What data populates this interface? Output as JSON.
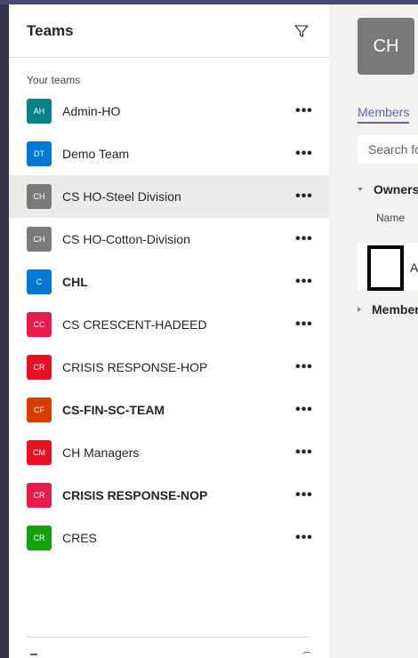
{
  "teams_pane": {
    "title": "Teams",
    "filter_icon": "filter-icon",
    "section_label": "Your teams",
    "more_icon": "more-options-icon",
    "more_glyph": "•••",
    "teams": [
      {
        "initials": "AH",
        "name": "Admin-HO",
        "color": "#038387",
        "bold": false,
        "selected": false
      },
      {
        "initials": "DT",
        "name": "Demo Team",
        "color": "#0078d4",
        "bold": false,
        "selected": false
      },
      {
        "initials": "CH",
        "name": "CS HO-Steel Division",
        "color": "#7a7a7a",
        "bold": false,
        "selected": true
      },
      {
        "initials": "CH",
        "name": "CS HO-Cotton-Division",
        "color": "#7a7a7a",
        "bold": false,
        "selected": false
      },
      {
        "initials": "C",
        "name": "CHL",
        "color": "#0078d4",
        "bold": true,
        "selected": false
      },
      {
        "initials": "CC",
        "name": "CS CRESCENT-HADEED",
        "color": "#e81b4c",
        "bold": false,
        "selected": false
      },
      {
        "initials": "CR",
        "name": "CRISIS RESPONSE-HOP",
        "color": "#e81123",
        "bold": false,
        "selected": false
      },
      {
        "initials": "CF",
        "name": "CS-FIN-SC-TEAM",
        "color": "#da3b01",
        "bold": true,
        "selected": false
      },
      {
        "initials": "CM",
        "name": "CH Managers",
        "color": "#e81123",
        "bold": false,
        "selected": false
      },
      {
        "initials": "CR",
        "name": "CRISIS RESPONSE-NOP",
        "color": "#e81b4c",
        "bold": true,
        "selected": false
      },
      {
        "initials": "CR",
        "name": "CRES",
        "color": "#13a10e",
        "bold": false,
        "selected": false
      }
    ]
  },
  "main_pane": {
    "team_avatar": "CH",
    "members_tab": "Members",
    "search_placeholder": "Search for",
    "owners_section": "Owners",
    "name_column": "Name",
    "member_initial": "A",
    "members_section": "Members"
  },
  "colors": {
    "accent": "#6264a7",
    "rail": "#33344a",
    "selected_row": "#edebe9"
  }
}
